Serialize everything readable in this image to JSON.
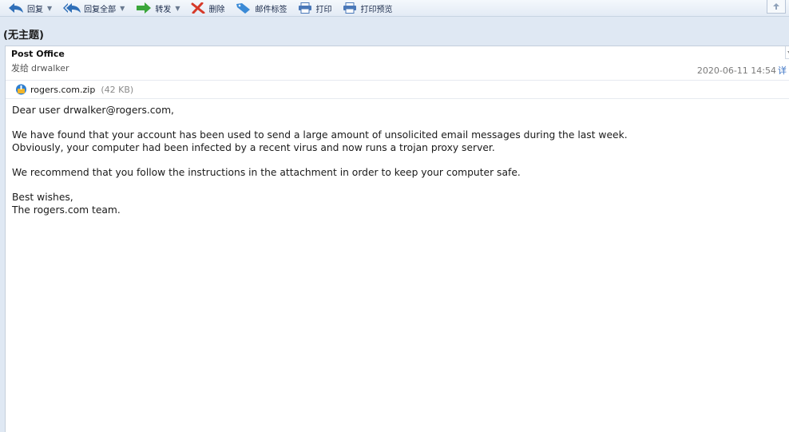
{
  "toolbar": {
    "reply_label": "回复",
    "reply_all_label": "回复全部",
    "forward_label": "转发",
    "delete_label": "删除",
    "tag_label": "邮件标签",
    "print_label": "打印",
    "print_preview_label": "打印预览"
  },
  "subject": "(无主题)",
  "message": {
    "sender": "Post Office",
    "to_label": "发给",
    "recipient": "drwalker",
    "date": "2020-06-11 14:54",
    "detail_link": "详",
    "attachment": {
      "name": "rogers.com.zip",
      "size": "(42 KB)"
    },
    "body": {
      "greeting": "Dear user drwalker@rogers.com,",
      "p1_line1": "We have found that your account has been used to send a large amount of unsolicited email messages during the last week.",
      "p1_line2": "Obviously, your computer had been infected by a recent virus and now runs a trojan proxy server.",
      "p2": "We recommend that you follow the instructions in the attachment in order to keep your computer safe.",
      "closing": "Best wishes,",
      "signature": "The rogers.com team."
    }
  },
  "colors": {
    "accent": "#3a72c4",
    "window_bg": "#dfe8f3",
    "panel_bg": "#ffffff"
  }
}
